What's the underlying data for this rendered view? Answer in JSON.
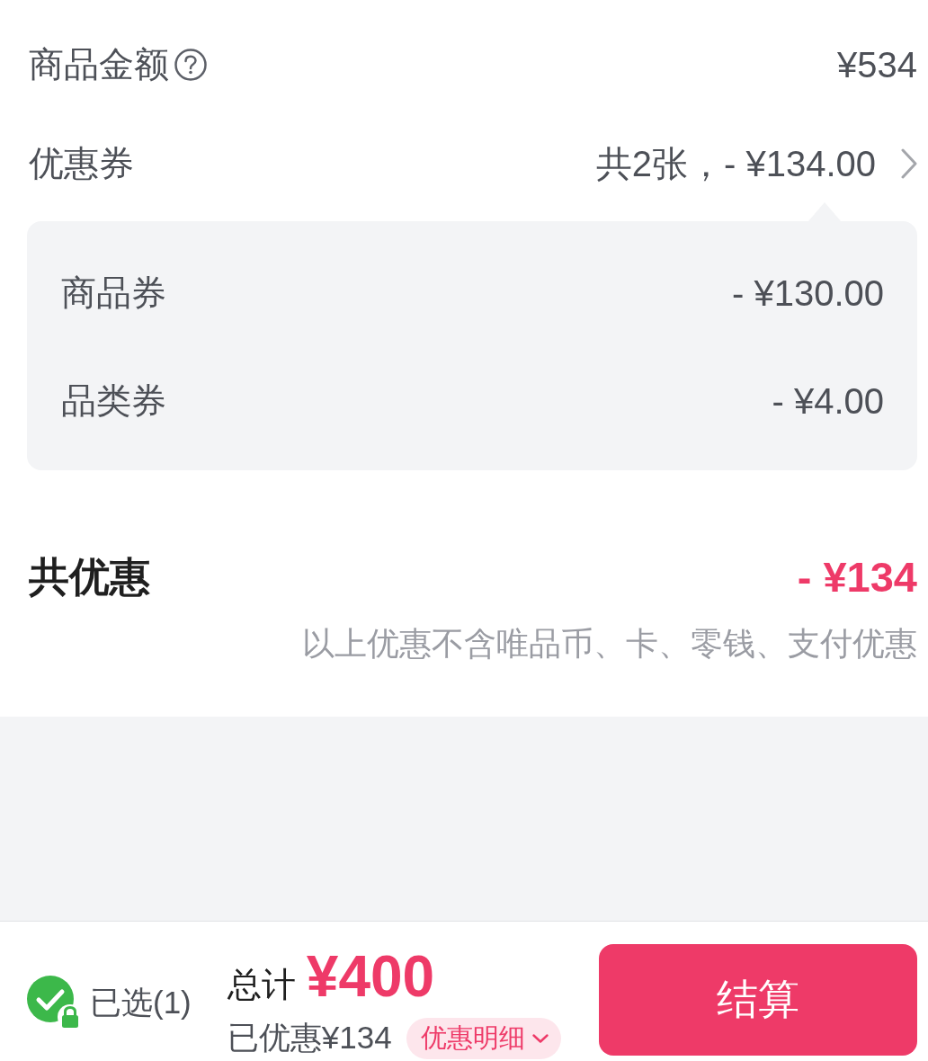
{
  "goods_amount": {
    "label": "商品金额",
    "help": true,
    "value": "¥534"
  },
  "coupons": {
    "label": "优惠券",
    "value": "共2张，- ¥134.00",
    "expanded": true,
    "items": [
      {
        "label": "商品券",
        "value": "- ¥130.00"
      },
      {
        "label": "品类券",
        "value": "- ¥4.00"
      }
    ]
  },
  "total_discount": {
    "label": "共优惠",
    "value": "- ¥134",
    "note": "以上优惠不含唯品币、卡、零钱、支付优惠"
  },
  "bottom_bar": {
    "checked": true,
    "selected_label": "已选(1)",
    "total_label": "总计",
    "total_value": "¥400",
    "saved": "已优惠¥134",
    "details_label": "优惠明细",
    "checkout_label": "结算"
  }
}
